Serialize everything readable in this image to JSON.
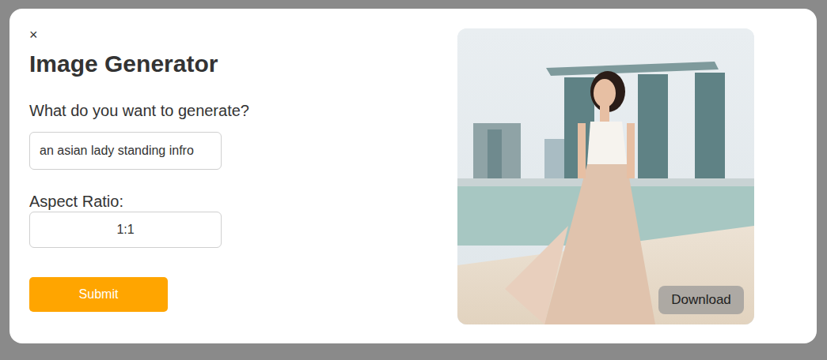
{
  "dialog": {
    "close": "×",
    "title": "Image Generator"
  },
  "prompt": {
    "label": "What do you want to generate?",
    "value": "an asian lady standing infro"
  },
  "aspect_ratio": {
    "label": "Aspect Ratio:",
    "value": "1:1"
  },
  "buttons": [
    "Submit"
  ],
  "result": {
    "download": "Download"
  }
}
